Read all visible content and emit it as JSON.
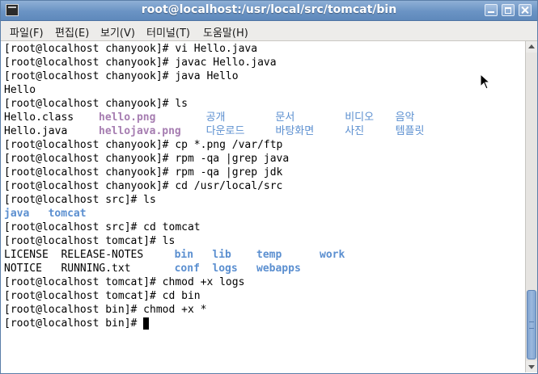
{
  "window": {
    "title": "root@localhost:/usr/local/src/tomcat/bin"
  },
  "menu": {
    "items": [
      "파일(F)",
      "편집(E)",
      "보기(V)",
      "터미널(T)",
      "도움말(H)"
    ]
  },
  "colors": {
    "blue": "#5b8fd0",
    "purple": "#a67db1",
    "text": "#000000"
  },
  "terminal": {
    "lines": [
      [
        {
          "t": "[root@localhost chanyook]# vi Hello.java"
        }
      ],
      [
        {
          "t": "[root@localhost chanyook]# javac Hello.java"
        }
      ],
      [
        {
          "t": "[root@localhost chanyook]# java Hello"
        }
      ],
      [
        {
          "t": "Hello"
        }
      ],
      [
        {
          "t": "[root@localhost chanyook]# ls"
        }
      ],
      [
        {
          "t": "Hello.class"
        },
        {
          "t": "hello.png",
          "c": "purple",
          "b": true,
          "col": 15
        },
        {
          "t": "공개",
          "c": "blue",
          "col": 32
        },
        {
          "t": "문서",
          "c": "blue",
          "col": 43
        },
        {
          "t": "비디오",
          "c": "blue",
          "col": 54
        },
        {
          "t": "음악",
          "c": "blue",
          "col": 62
        }
      ],
      [
        {
          "t": "Hello.java"
        },
        {
          "t": "hellojava.png",
          "c": "purple",
          "b": true,
          "col": 15
        },
        {
          "t": "다운로드",
          "c": "blue",
          "col": 32
        },
        {
          "t": "바탕화면",
          "c": "blue",
          "col": 43
        },
        {
          "t": "사진",
          "c": "blue",
          "col": 54
        },
        {
          "t": "템플릿",
          "c": "blue",
          "col": 62
        }
      ],
      [
        {
          "t": "[root@localhost chanyook]# cp *.png /var/ftp"
        }
      ],
      [
        {
          "t": "[root@localhost chanyook]# rpm -qa |grep java"
        }
      ],
      [
        {
          "t": "[root@localhost chanyook]# rpm -qa |grep jdk"
        }
      ],
      [
        {
          "t": "[root@localhost chanyook]# cd /usr/local/src"
        }
      ],
      [
        {
          "t": "[root@localhost src]# ls"
        }
      ],
      [
        {
          "t": "java",
          "c": "blue",
          "b": true
        },
        {
          "t": "tomcat",
          "c": "blue",
          "b": true,
          "col": 7
        }
      ],
      [
        {
          "t": "[root@localhost src]# cd tomcat"
        }
      ],
      [
        {
          "t": "[root@localhost tomcat]# ls"
        }
      ],
      [
        {
          "t": "LICENSE  RELEASE-NOTES"
        },
        {
          "t": "bin",
          "c": "blue",
          "b": true,
          "col": 27
        },
        {
          "t": "lib",
          "c": "blue",
          "b": true,
          "col": 33
        },
        {
          "t": "temp",
          "c": "blue",
          "b": true,
          "col": 40
        },
        {
          "t": "work",
          "c": "blue",
          "b": true,
          "col": 50
        }
      ],
      [
        {
          "t": "NOTICE   RUNNING.txt"
        },
        {
          "t": "conf",
          "c": "blue",
          "b": true,
          "col": 27
        },
        {
          "t": "logs",
          "c": "blue",
          "b": true,
          "col": 33
        },
        {
          "t": "webapps",
          "c": "blue",
          "b": true,
          "col": 40
        }
      ],
      [
        {
          "t": "[root@localhost tomcat]# chmod +x logs"
        }
      ],
      [
        {
          "t": "[root@localhost tomcat]# cd bin"
        }
      ],
      [
        {
          "t": "[root@localhost bin]# chmod +x *"
        }
      ],
      [
        {
          "t": "[root@localhost bin]# "
        }
      ]
    ]
  }
}
